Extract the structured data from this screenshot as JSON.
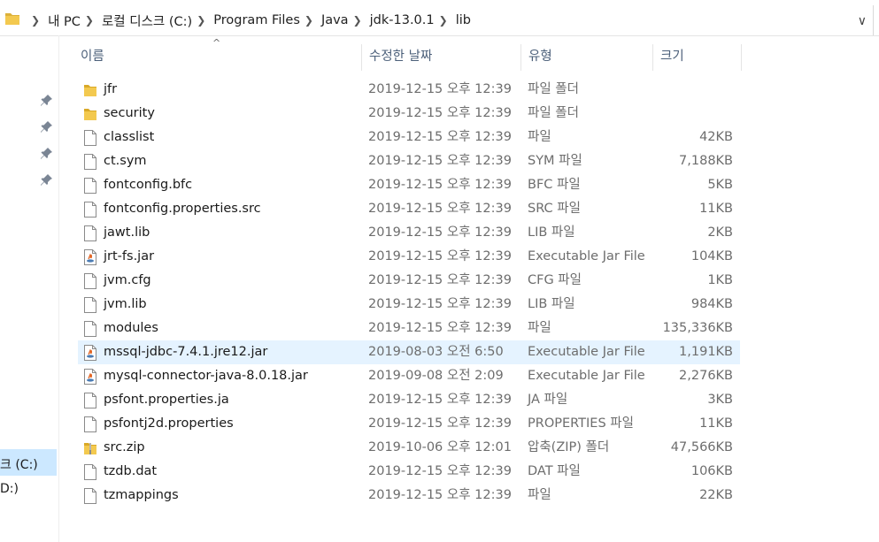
{
  "address_bar": {
    "crumbs": [
      "내 PC",
      "로컬 디스크 (C:)",
      "Program Files",
      "Java",
      "jdk-13.0.1",
      "lib"
    ]
  },
  "nav": {
    "drive_c_label": "크 (C:)",
    "drive_d_label": "D:)"
  },
  "columns": {
    "name": "이름",
    "date": "수정한 날짜",
    "type": "유형",
    "size": "크기"
  },
  "files": [
    {
      "name": "jfr",
      "date": "2019-12-15 오후 12:39",
      "type": "파일 폴더",
      "size": "",
      "icon": "folder-icon"
    },
    {
      "name": "security",
      "date": "2019-12-15 오후 12:39",
      "type": "파일 폴더",
      "size": "",
      "icon": "folder-icon"
    },
    {
      "name": "classlist",
      "date": "2019-12-15 오후 12:39",
      "type": "파일",
      "size": "42KB",
      "icon": "file-icon"
    },
    {
      "name": "ct.sym",
      "date": "2019-12-15 오후 12:39",
      "type": "SYM 파일",
      "size": "7,188KB",
      "icon": "file-icon"
    },
    {
      "name": "fontconfig.bfc",
      "date": "2019-12-15 오후 12:39",
      "type": "BFC 파일",
      "size": "5KB",
      "icon": "file-icon"
    },
    {
      "name": "fontconfig.properties.src",
      "date": "2019-12-15 오후 12:39",
      "type": "SRC 파일",
      "size": "11KB",
      "icon": "file-icon"
    },
    {
      "name": "jawt.lib",
      "date": "2019-12-15 오후 12:39",
      "type": "LIB 파일",
      "size": "2KB",
      "icon": "file-icon"
    },
    {
      "name": "jrt-fs.jar",
      "date": "2019-12-15 오후 12:39",
      "type": "Executable Jar File",
      "size": "104KB",
      "icon": "jar-icon"
    },
    {
      "name": "jvm.cfg",
      "date": "2019-12-15 오후 12:39",
      "type": "CFG 파일",
      "size": "1KB",
      "icon": "file-icon"
    },
    {
      "name": "jvm.lib",
      "date": "2019-12-15 오후 12:39",
      "type": "LIB 파일",
      "size": "984KB",
      "icon": "file-icon"
    },
    {
      "name": "modules",
      "date": "2019-12-15 오후 12:39",
      "type": "파일",
      "size": "135,336KB",
      "icon": "file-icon"
    },
    {
      "name": "mssql-jdbc-7.4.1.jre12.jar",
      "date": "2019-08-03 오전 6:50",
      "type": "Executable Jar File",
      "size": "1,191KB",
      "icon": "jar-icon",
      "selected": true
    },
    {
      "name": "mysql-connector-java-8.0.18.jar",
      "date": "2019-09-08 오전 2:09",
      "type": "Executable Jar File",
      "size": "2,276KB",
      "icon": "jar-icon"
    },
    {
      "name": "psfont.properties.ja",
      "date": "2019-12-15 오후 12:39",
      "type": "JA 파일",
      "size": "3KB",
      "icon": "file-icon"
    },
    {
      "name": "psfontj2d.properties",
      "date": "2019-12-15 오후 12:39",
      "type": "PROPERTIES 파일",
      "size": "11KB",
      "icon": "file-icon"
    },
    {
      "name": "src.zip",
      "date": "2019-10-06 오후 12:01",
      "type": "압축(ZIP) 폴더",
      "size": "47,566KB",
      "icon": "zip-folder-icon"
    },
    {
      "name": "tzdb.dat",
      "date": "2019-12-15 오후 12:39",
      "type": "DAT 파일",
      "size": "106KB",
      "icon": "file-icon"
    },
    {
      "name": "tzmappings",
      "date": "2019-12-15 오후 12:39",
      "type": "파일",
      "size": "22KB",
      "icon": "file-icon"
    }
  ]
}
